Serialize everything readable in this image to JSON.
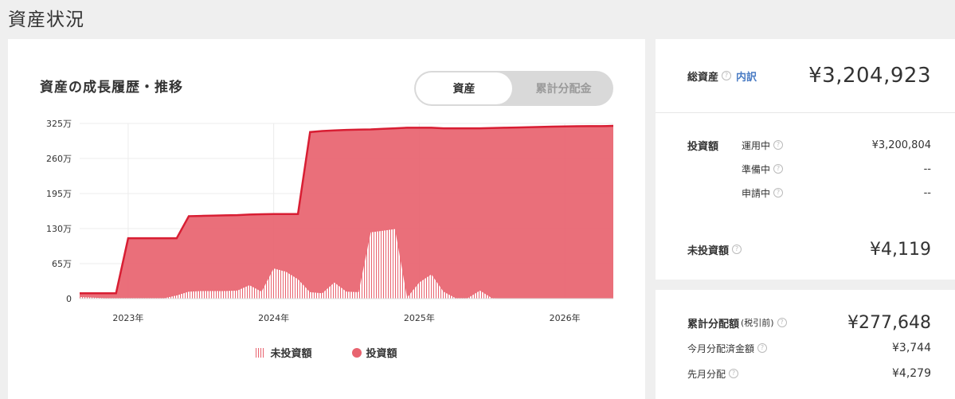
{
  "page_title": "資産状況",
  "chart_card": {
    "title": "資産の成長履歴・推移",
    "toggle": {
      "active": "資産",
      "inactive": "累計分配金"
    },
    "legend": {
      "uninvested": "未投資額",
      "invested": "投資額"
    }
  },
  "chart_data": {
    "type": "area",
    "x": [
      "2022-09",
      "2022-10",
      "2022-11",
      "2022-12",
      "2023-01",
      "2023-02",
      "2023-03",
      "2023-04",
      "2023-05",
      "2023-06",
      "2023-07",
      "2023-08",
      "2023-09",
      "2023-10",
      "2023-11",
      "2023-12",
      "2024-01",
      "2024-02",
      "2024-03",
      "2024-04",
      "2024-05",
      "2024-06",
      "2024-07",
      "2024-08",
      "2024-09",
      "2024-10",
      "2024-11",
      "2024-12",
      "2025-01",
      "2025-02",
      "2025-03",
      "2025-04",
      "2025-05",
      "2025-06",
      "2025-07",
      "2025-08",
      "2025-09",
      "2025-10",
      "2025-11",
      "2025-12",
      "2026-01",
      "2026-02",
      "2026-03",
      "2026-04",
      "2026-05"
    ],
    "x_ticks": [
      "2023年",
      "2024年",
      "2025年",
      "2026年"
    ],
    "y_ticks": [
      "0",
      "65万",
      "130万",
      "195万",
      "260万",
      "325万"
    ],
    "ylim": [
      0,
      3250000
    ],
    "series": [
      {
        "name": "投資額",
        "color": "#e8636f",
        "values": [
          100000,
          100000,
          100000,
          100000,
          1120000,
          1120000,
          1120000,
          1120000,
          1120000,
          1530000,
          1535000,
          1540000,
          1545000,
          1550000,
          1560000,
          1565000,
          1570000,
          1570000,
          1570000,
          3090000,
          3110000,
          3120000,
          3130000,
          3135000,
          3140000,
          3150000,
          3160000,
          3170000,
          3170000,
          3170000,
          3160000,
          3160000,
          3160000,
          3160000,
          3165000,
          3170000,
          3175000,
          3180000,
          3185000,
          3190000,
          3195000,
          3198000,
          3200000,
          3200000,
          3204923
        ]
      },
      {
        "name": "未投資額",
        "color": "#e8636f",
        "values": [
          30000,
          20000,
          10000,
          10000,
          10000,
          10000,
          10000,
          10000,
          60000,
          130000,
          140000,
          140000,
          140000,
          150000,
          250000,
          130000,
          560000,
          500000,
          360000,
          120000,
          100000,
          300000,
          130000,
          120000,
          1230000,
          1260000,
          1290000,
          20000,
          300000,
          450000,
          130000,
          10000,
          10000,
          150000,
          10000,
          5000,
          5000,
          5000,
          5000,
          5000,
          4119,
          4119,
          4119,
          4119,
          4119
        ]
      }
    ]
  },
  "summary": {
    "total_assets_label": "総資産",
    "breakdown_link": "内訳",
    "total_assets_value": "¥3,204,923",
    "invested_label": "投資額",
    "operating_label": "運用中",
    "operating_value": "¥3,200,804",
    "preparing_label": "準備中",
    "preparing_value": "--",
    "applying_label": "申請中",
    "applying_value": "--",
    "uninvested_label": "未投資額",
    "uninvested_value": "¥4,119"
  },
  "distribution": {
    "cumulative_label": "累計分配額",
    "cumulative_note": "(税引前)",
    "cumulative_value": "¥277,648",
    "this_month_label": "今月分配済金額",
    "this_month_value": "¥3,744",
    "last_month_label": "先月分配",
    "last_month_value": "¥4,279"
  }
}
